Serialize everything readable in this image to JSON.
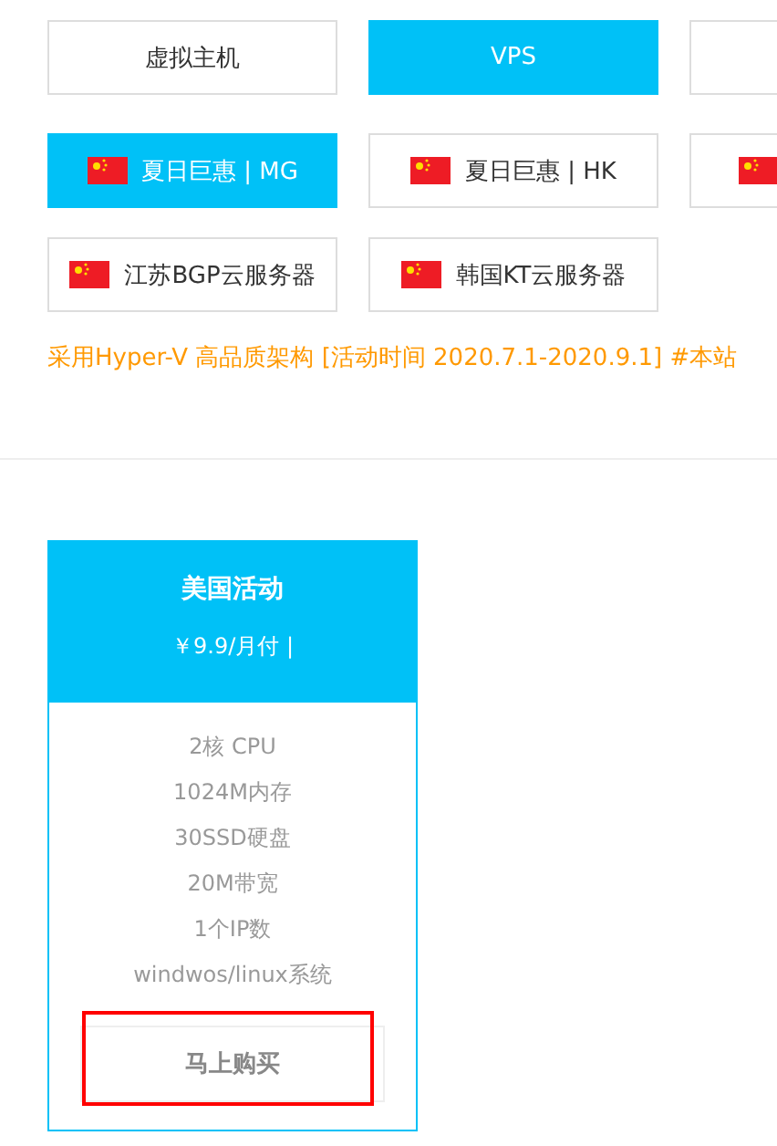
{
  "categories": [
    {
      "label": "虚拟主机",
      "selected": false
    },
    {
      "label": "VPS",
      "selected": true
    },
    {
      "selected": false
    }
  ],
  "locations": [
    {
      "label": "夏日巨惠 | MG",
      "selected": true
    },
    {
      "label": "夏日巨惠 | HK",
      "selected": false
    },
    {
      "selected": false
    },
    {
      "label": "江苏BGP云服务器",
      "selected": false
    },
    {
      "label": "韩国KT云服务器",
      "selected": false
    }
  ],
  "notice": "采用Hyper-V 高品质架构 [活动时间 2020.7.1-2020.9.1] #本站",
  "plan": {
    "title": "美国活动",
    "price": "￥9.9/月付 |",
    "features": [
      "2核 CPU",
      "1024M内存",
      "30SSD硬盘",
      "20M带宽",
      "1个IP数",
      "windwos/linux系统"
    ],
    "button": "马上购买",
    "highlighted": true
  }
}
